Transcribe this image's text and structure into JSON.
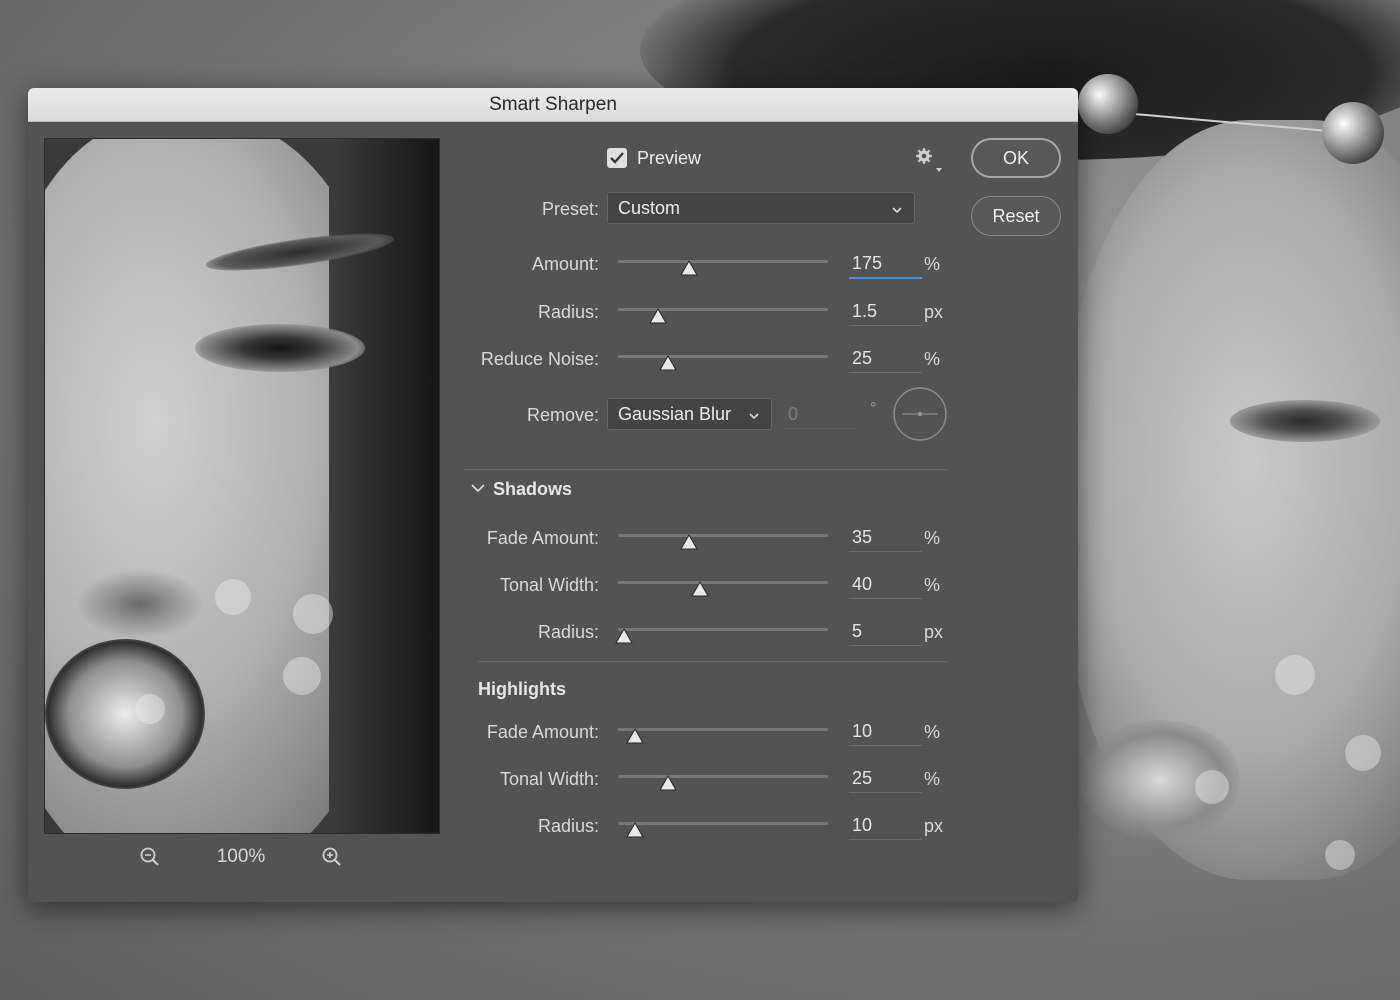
{
  "dialog": {
    "title": "Smart Sharpen"
  },
  "preview": {
    "label": "Preview",
    "checked": true
  },
  "zoom": {
    "level": "100%"
  },
  "buttons": {
    "ok": "OK",
    "reset": "Reset"
  },
  "preset": {
    "label": "Preset:",
    "value": "Custom"
  },
  "main_controls": [
    {
      "label": "Amount:",
      "value": "175",
      "unit": "%",
      "fraction": 0.34
    },
    {
      "label": "Radius:",
      "value": "1.5",
      "unit": "px",
      "fraction": 0.19
    },
    {
      "label": "Reduce Noise:",
      "value": "25",
      "unit": "%",
      "fraction": 0.24
    }
  ],
  "remove": {
    "label": "Remove:",
    "value": "Gaussian Blur",
    "angle_value": "0",
    "angle_unit": "°"
  },
  "shadows": {
    "title": "Shadows",
    "controls": [
      {
        "label": "Fade Amount:",
        "value": "35",
        "unit": "%",
        "fraction": 0.34
      },
      {
        "label": "Tonal Width:",
        "value": "40",
        "unit": "%",
        "fraction": 0.39
      },
      {
        "label": "Radius:",
        "value": "5",
        "unit": "px",
        "fraction": 0.03
      }
    ]
  },
  "highlights": {
    "title": "Highlights",
    "controls": [
      {
        "label": "Fade Amount:",
        "value": "10",
        "unit": "%",
        "fraction": 0.08
      },
      {
        "label": "Tonal Width:",
        "value": "25",
        "unit": "%",
        "fraction": 0.24
      },
      {
        "label": "Radius:",
        "value": "10",
        "unit": "px",
        "fraction": 0.08
      }
    ]
  },
  "colors": {
    "accent": "#4a8fd9",
    "dialog_bg": "#535353"
  },
  "icons": {
    "gear": "gear-icon",
    "zoom_out": "zoom-out-icon",
    "zoom_in": "zoom-in-icon",
    "chevron": "chevron-down-icon",
    "angle_dial": "angle-dial-icon"
  }
}
